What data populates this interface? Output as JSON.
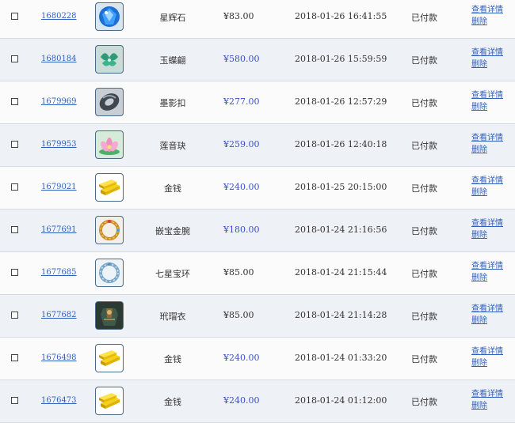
{
  "orders": [
    {
      "id": "1680228",
      "item": "星辉石",
      "item_icon": "blue-gem-icon",
      "price": "¥83.00",
      "price_highlight": false,
      "time": "2018-01-26 16:41:55",
      "status": "已付款"
    },
    {
      "id": "1680184",
      "item": "玉蝶翩",
      "item_icon": "jade-butterfly-icon",
      "price": "¥580.00",
      "price_highlight": true,
      "time": "2018-01-26 15:59:59",
      "status": "已付款"
    },
    {
      "id": "1679969",
      "item": "墨影扣",
      "item_icon": "ink-buckle-icon",
      "price": "¥277.00",
      "price_highlight": true,
      "time": "2018-01-26 12:57:29",
      "status": "已付款"
    },
    {
      "id": "1679953",
      "item": "莲音玦",
      "item_icon": "lotus-icon",
      "price": "¥259.00",
      "price_highlight": true,
      "time": "2018-01-26 12:40:18",
      "status": "已付款"
    },
    {
      "id": "1679021",
      "item": "金钱",
      "item_icon": "gold-bars-icon",
      "price": "¥240.00",
      "price_highlight": true,
      "time": "2018-01-25 20:15:00",
      "status": "已付款"
    },
    {
      "id": "1677691",
      "item": "嵌宝金腕",
      "item_icon": "gold-bracelet-icon",
      "price": "¥180.00",
      "price_highlight": true,
      "time": "2018-01-24 21:16:56",
      "status": "已付款"
    },
    {
      "id": "1677685",
      "item": "七星宝环",
      "item_icon": "blue-ring-icon",
      "price": "¥85.00",
      "price_highlight": false,
      "time": "2018-01-24 21:15:44",
      "status": "已付款"
    },
    {
      "id": "1677682",
      "item": "玳瑁衣",
      "item_icon": "armor-icon",
      "price": "¥85.00",
      "price_highlight": false,
      "time": "2018-01-24 21:14:28",
      "status": "已付款"
    },
    {
      "id": "1676498",
      "item": "金钱",
      "item_icon": "gold-bars-icon",
      "price": "¥240.00",
      "price_highlight": true,
      "time": "2018-01-24 01:33:20",
      "status": "已付款"
    },
    {
      "id": "1676473",
      "item": "金钱",
      "item_icon": "gold-bars-icon",
      "price": "¥240.00",
      "price_highlight": true,
      "time": "2018-01-24 01:12:00",
      "status": "已付款"
    }
  ],
  "actions": {
    "view_label": "查看详情",
    "delete_label": "删除"
  },
  "colors": {
    "link": "#3060c0",
    "price_highlight": "#3a4fd0",
    "row_alt": "#eef1f6",
    "row_plain": "#fbfbfc"
  }
}
